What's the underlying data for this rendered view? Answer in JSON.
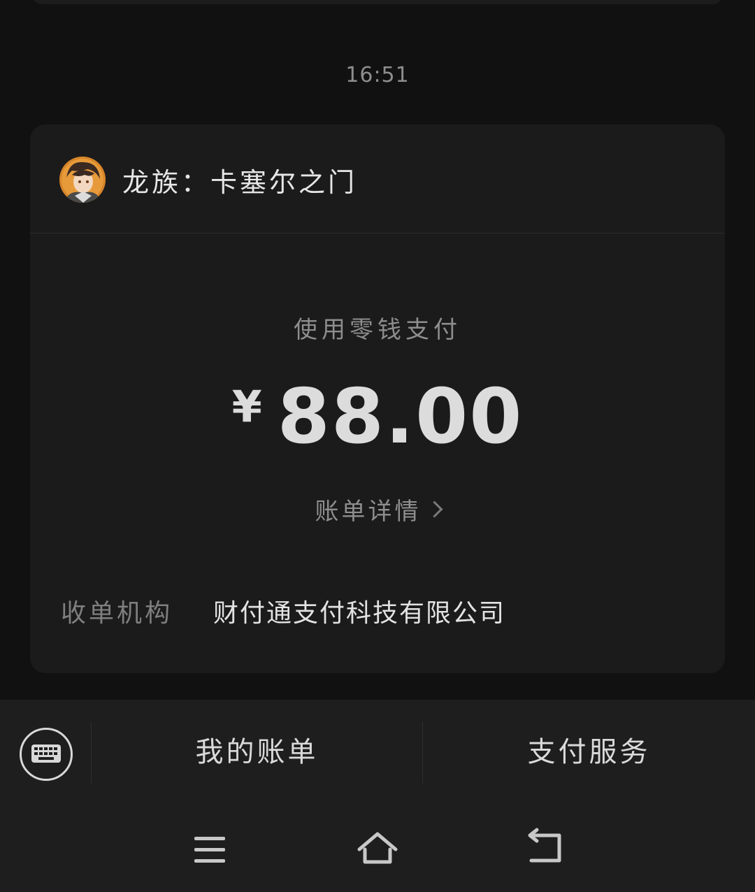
{
  "chat": {
    "timestamp": "16:51"
  },
  "payment_card": {
    "merchant_name": "龙族：卡塞尔之门",
    "pay_method": "使用零钱支付",
    "currency_symbol": "¥",
    "amount": "88.00",
    "bill_detail_label": "账单详情",
    "acquirer_label": "收单机构",
    "acquirer_value": "财付通支付科技有限公司"
  },
  "bottom_menu": {
    "my_bills_label": "我的账单",
    "pay_services_label": "支付服务"
  },
  "icons": {
    "avatar": "merchant-avatar",
    "chevron": "chevron-right-icon",
    "keyboard": "keyboard-icon",
    "menu": "menu-icon",
    "home": "home-icon",
    "back": "back-icon"
  },
  "colors": {
    "background": "#111111",
    "card": "#1b1b1b",
    "bar": "#1e1e1e",
    "text_primary": "#e6e6e6",
    "text_secondary": "#8e8e8e"
  }
}
